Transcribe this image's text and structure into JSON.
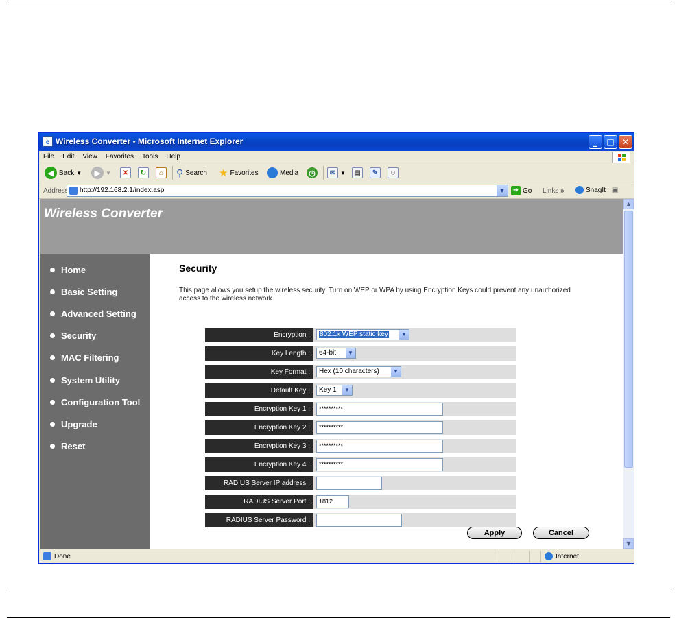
{
  "window": {
    "title": "Wireless Converter - Microsoft Internet Explorer"
  },
  "menu": [
    "File",
    "Edit",
    "View",
    "Favorites",
    "Tools",
    "Help"
  ],
  "toolbar": {
    "back": "Back",
    "search": "Search",
    "favorites": "Favorites",
    "media": "Media"
  },
  "address": {
    "label": "Address",
    "url": "http://192.168.2.1/index.asp",
    "go": "Go",
    "links": "Links",
    "snagit": "SnagIt"
  },
  "site": {
    "brand": "Wireless Converter"
  },
  "nav": [
    "Home",
    "Basic Setting",
    "Advanced Setting",
    "Security",
    "MAC Filtering",
    "System Utility",
    "Configuration Tool",
    "Upgrade",
    "Reset"
  ],
  "page": {
    "title": "Security",
    "description": "This page allows you setup the wireless security. Turn on WEP or WPA by using Encryption Keys could prevent any unauthorized access to the wireless network."
  },
  "form": {
    "encryption": {
      "label": "Encryption :",
      "value": "802.1x WEP static key"
    },
    "key_length": {
      "label": "Key Length :",
      "value": "64-bit"
    },
    "key_format": {
      "label": "Key Format :",
      "value": "Hex (10 characters)"
    },
    "default_key": {
      "label": "Default Key :",
      "value": "Key 1"
    },
    "key1": {
      "label": "Encryption Key 1 :",
      "value": "**********"
    },
    "key2": {
      "label": "Encryption Key 2 :",
      "value": "**********"
    },
    "key3": {
      "label": "Encryption Key 3 :",
      "value": "**********"
    },
    "key4": {
      "label": "Encryption Key 4 :",
      "value": "**********"
    },
    "radius_ip": {
      "label": "RADIUS Server IP address :",
      "value": ""
    },
    "radius_port": {
      "label": "RADIUS Server Port :",
      "value": "1812"
    },
    "radius_password": {
      "label": "RADIUS Server Password :",
      "value": ""
    }
  },
  "buttons": {
    "apply": "Apply",
    "cancel": "Cancel"
  },
  "status": {
    "left": "Done",
    "zone": "Internet"
  }
}
